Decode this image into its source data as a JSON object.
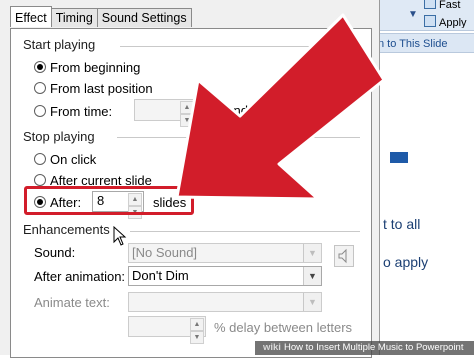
{
  "dialog": {
    "tabs": [
      {
        "label": "Effect",
        "active": true
      },
      {
        "label": "Timing",
        "active": false
      },
      {
        "label": "Sound Settings",
        "active": false
      }
    ]
  },
  "start_playing": {
    "heading": "Start playing",
    "from_beginning": "From beginning",
    "from_last_position": "From last position",
    "from_time": "From time:",
    "time_value": "",
    "seconds_label": "seconds",
    "selected": "from_beginning"
  },
  "stop_playing": {
    "heading": "Stop playing",
    "on_click": "On click",
    "after_current_slide": "After current slide",
    "after": "After:",
    "after_value": "8",
    "slides_label": "slides",
    "selected": "after"
  },
  "enhancements": {
    "heading": "Enhancements",
    "sound_label": "Sound:",
    "sound_value": "[No Sound]",
    "after_animation_label": "After animation:",
    "after_animation_value": "Don't Dim",
    "animate_text_label": "Animate text:",
    "animate_text_value": "",
    "delay_value": "",
    "delay_label": "% delay between letters"
  },
  "background_app": {
    "ribbon_button_1": "Fast",
    "ribbon_button_2": "Apply",
    "pane_header": "n to This Slide",
    "text_1": "t to all",
    "text_2": "o apply"
  },
  "watermark": {
    "brand": "wiki",
    "title": "How to Insert Multiple Music to Powerpoint"
  },
  "colors": {
    "highlight_red": "#d21d2a",
    "accent_blue": "#1e5aa8"
  },
  "icons": {
    "speaker": "speaker-icon",
    "cursor": "mouse-pointer-icon",
    "pointer_arrow": "red-arrow-annotation"
  }
}
